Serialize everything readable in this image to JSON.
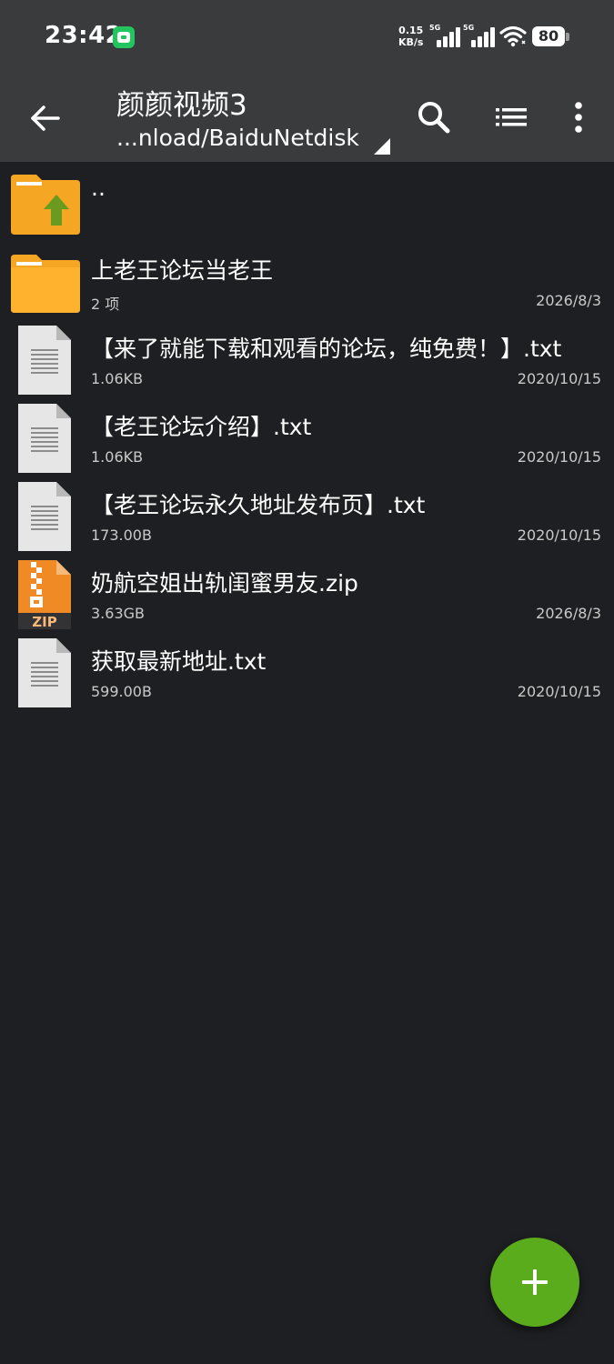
{
  "status_bar": {
    "time": "23:42",
    "net_speed_value": "0.15",
    "net_speed_unit": "KB/s",
    "sim1_label": "5G",
    "sim2_label": "5G",
    "battery": "80"
  },
  "toolbar": {
    "title": "颜颜视频3",
    "path": "...nload/BaiduNetdisk"
  },
  "files": [
    {
      "name": "..",
      "meta": "",
      "date": "",
      "type": "parent"
    },
    {
      "name": "上老王论坛当老王",
      "meta": "2 项",
      "date": "2026/8/3",
      "type": "folder"
    },
    {
      "name": "【来了就能下载和观看的论坛，纯免费！】.txt",
      "meta": "1.06KB",
      "date": "2020/10/15",
      "type": "txt"
    },
    {
      "name": "【老王论坛介绍】.txt",
      "meta": "1.06KB",
      "date": "2020/10/15",
      "type": "txt"
    },
    {
      "name": "【老王论坛永久地址发布页】.txt",
      "meta": "173.00B",
      "date": "2020/10/15",
      "type": "txt"
    },
    {
      "name": "奶航空姐出轨闺蜜男友.zip",
      "meta": "3.63GB",
      "date": "2026/8/3",
      "type": "zip",
      "badge": "ZIP"
    },
    {
      "name": "获取最新地址.txt",
      "meta": "599.00B",
      "date": "2020/10/15",
      "type": "txt"
    }
  ],
  "colors": {
    "folder": "#f9a825",
    "folder_tab": "#fbc02d",
    "up_arrow": "#6b9b1e",
    "fab": "#5aac1c",
    "zip": "#f08a24"
  }
}
